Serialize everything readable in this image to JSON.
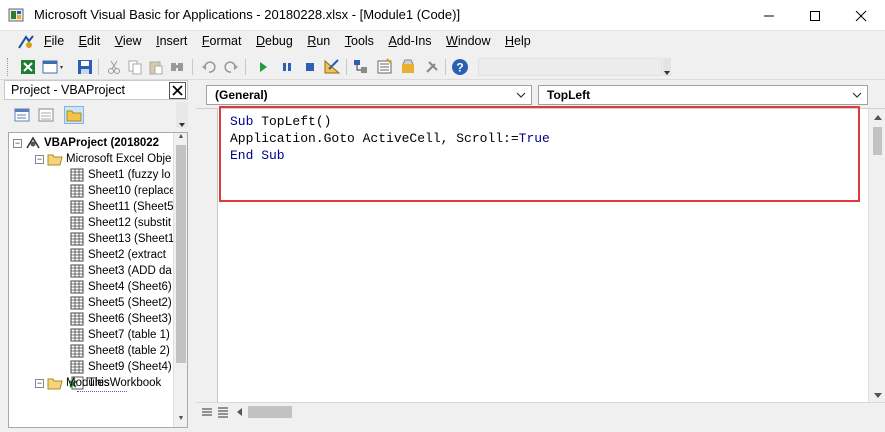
{
  "window": {
    "title": "Microsoft Visual Basic for Applications - 20180228.xlsx - [Module1 (Code)]",
    "controls": [
      "minimize-icon",
      "maximize-icon",
      "close-icon"
    ]
  },
  "menu": {
    "items": [
      {
        "label": "File"
      },
      {
        "label": "Edit"
      },
      {
        "label": "View"
      },
      {
        "label": "Insert"
      },
      {
        "label": "Format"
      },
      {
        "label": "Debug"
      },
      {
        "label": "Run"
      },
      {
        "label": "Tools"
      },
      {
        "label": "Add-Ins"
      },
      {
        "label": "Window"
      },
      {
        "label": "Help"
      }
    ]
  },
  "toolbar": {
    "icons": [
      "view-excel-icon",
      "insert-module-icon",
      "save-icon",
      "cut-icon",
      "copy-icon",
      "paste-icon",
      "find-icon",
      "undo-icon",
      "redo-icon",
      "run-icon",
      "break-icon",
      "reset-icon",
      "design-mode-icon",
      "project-explorer-icon",
      "properties-icon",
      "object-browser-icon",
      "toolbox-icon",
      "help-icon"
    ]
  },
  "project_pane": {
    "title": "Project - VBAProject",
    "tree": [
      {
        "label": "VBAProject (2018022",
        "level": 0,
        "bold": true,
        "expander": "−"
      },
      {
        "label": "Microsoft Excel Obje",
        "level": 1,
        "expander": "−"
      },
      {
        "label": "Sheet1 (fuzzy lo",
        "level": 2
      },
      {
        "label": "Sheet10 (replace",
        "level": 2
      },
      {
        "label": "Sheet11 (Sheet5",
        "level": 2
      },
      {
        "label": "Sheet12 (substit",
        "level": 2
      },
      {
        "label": "Sheet13 (Sheet1",
        "level": 2
      },
      {
        "label": "Sheet2 (extract",
        "level": 2
      },
      {
        "label": "Sheet3 (ADD da",
        "level": 2
      },
      {
        "label": "Sheet4 (Sheet6)",
        "level": 2
      },
      {
        "label": "Sheet5 (Sheet2)",
        "level": 2
      },
      {
        "label": "Sheet6 (Sheet3)",
        "level": 2
      },
      {
        "label": "Sheet7 (table 1)",
        "level": 2
      },
      {
        "label": "Sheet8 (table 2)",
        "level": 2
      },
      {
        "label": "Sheet9 (Sheet4)",
        "level": 2
      },
      {
        "label": "ThisWorkbook",
        "level": 2
      },
      {
        "label": "Modules",
        "level": 1,
        "expander": "−"
      }
    ]
  },
  "code_window": {
    "object_combo": "(General)",
    "procedure_combo": "TopLeft",
    "lines": [
      {
        "kw": "Sub",
        "rest": " TopLeft()"
      },
      {
        "pre": "Application.Goto ActiveCell, Scroll:=",
        "kw": "True"
      },
      {
        "kw": "End Sub",
        "rest": ""
      }
    ]
  },
  "colors": {
    "highlight_border": "#e0393e",
    "keyword": "#00008b"
  }
}
